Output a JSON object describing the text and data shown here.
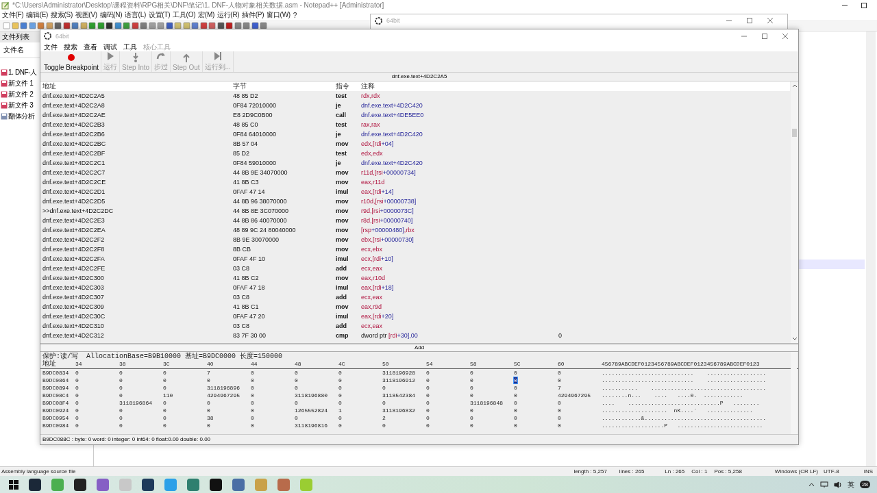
{
  "notepad": {
    "title": "*C:\\Users\\Administrator\\Desktop\\课程资料\\RPG相关\\DNF\\笔记\\1. DNF-人物对象相关数据.asm - Notepad++ [Administrator]",
    "menu": [
      "文件(F)",
      "编辑(E)",
      "搜索(S)",
      "视图(V)",
      "编码(N)",
      "语言(L)",
      "设置(T)",
      "工具(O)",
      "宏(M)",
      "运行(R)",
      "插件(P)",
      "窗口(W)",
      "?"
    ],
    "file_panel": {
      "title": "文件列表",
      "column": "文件名",
      "files": [
        "1. DNF-人",
        "新文件 1",
        "新文件 2",
        "新文件 3",
        "翻体分析"
      ]
    },
    "status_bar": {
      "file_type": "Assembly language source file",
      "length": "length : 5,257",
      "lines": "lines : 265",
      "ln": "Ln : 265",
      "col": "Col : 1",
      "pos": "Pos : 5,258",
      "eol": "Windows (CR LF)",
      "encoding": "UTF-8",
      "mode": "INS"
    }
  },
  "back_window": {
    "title": "64bit"
  },
  "debugger": {
    "title": "64bit",
    "menu": [
      {
        "label": "文件",
        "disabled": false
      },
      {
        "label": "搜索",
        "disabled": false
      },
      {
        "label": "查看",
        "disabled": false
      },
      {
        "label": "调试",
        "disabled": false
      },
      {
        "label": "工具",
        "disabled": false
      },
      {
        "label": "核心工具",
        "disabled": true
      }
    ],
    "toolbar": [
      {
        "kind": "breakpoint",
        "label": "Toggle Breakpoint",
        "disabled": false
      },
      {
        "kind": "run",
        "label": "运行",
        "disabled": true
      },
      {
        "kind": "step-into",
        "label": "Step Into",
        "disabled": true
      },
      {
        "kind": "step-over",
        "label": "步过",
        "disabled": true
      },
      {
        "kind": "step-out",
        "label": "Step Out",
        "disabled": true
      },
      {
        "kind": "run-to",
        "label": "运行到...",
        "disabled": true
      }
    ],
    "location": "dnf.exe.text+4D2C2A5",
    "columns": [
      "地址",
      "字节",
      "指令",
      "注释"
    ],
    "rows": [
      {
        "address": "dnf.exe.text+4D2C2A5",
        "bytes": "48 85 D2",
        "opcode": "test",
        "operand": [
          {
            "text": "rdx,rdx",
            "kind": "reg"
          }
        ]
      },
      {
        "address": "dnf.exe.text+4D2C2A8",
        "bytes": "0F84 72010000",
        "opcode": "je",
        "operand": [
          {
            "text": "dnf.exe.text+4D2C420",
            "kind": "num"
          }
        ]
      },
      {
        "address": "dnf.exe.text+4D2C2AE",
        "bytes": "E8 2D9C0B00",
        "opcode": "call",
        "operand": [
          {
            "text": "dnf.exe.text+4DE5EE0",
            "kind": "num"
          }
        ]
      },
      {
        "address": "dnf.exe.text+4D2C2B3",
        "bytes": "48 85 C0",
        "opcode": "test",
        "operand": [
          {
            "text": "rax,rax",
            "kind": "reg"
          }
        ]
      },
      {
        "address": "dnf.exe.text+4D2C2B6",
        "bytes": "0F84 64010000",
        "opcode": "je",
        "operand": [
          {
            "text": "dnf.exe.text+4D2C420",
            "kind": "num"
          }
        ]
      },
      {
        "address": "dnf.exe.text+4D2C2BC",
        "bytes": "8B 57 04",
        "opcode": "mov",
        "operand": [
          {
            "text": "edx,[rdi",
            "kind": "reg"
          },
          {
            "text": "+04]",
            "kind": "num"
          }
        ]
      },
      {
        "address": "dnf.exe.text+4D2C2BF",
        "bytes": "85 D2",
        "opcode": "test",
        "operand": [
          {
            "text": "edx,edx",
            "kind": "reg"
          }
        ]
      },
      {
        "address": "dnf.exe.text+4D2C2C1",
        "bytes": "0F84 59010000",
        "opcode": "je",
        "operand": [
          {
            "text": "dnf.exe.text+4D2C420",
            "kind": "num"
          }
        ]
      },
      {
        "address": "dnf.exe.text+4D2C2C7",
        "bytes": "44 8B 9E 34070000",
        "opcode": "mov",
        "operand": [
          {
            "text": "r11d,[rsi",
            "kind": "reg"
          },
          {
            "text": "+00000734]",
            "kind": "num"
          }
        ]
      },
      {
        "address": "dnf.exe.text+4D2C2CE",
        "bytes": "41 8B C3",
        "opcode": "mov",
        "operand": [
          {
            "text": "eax,r11d",
            "kind": "reg"
          }
        ]
      },
      {
        "address": "dnf.exe.text+4D2C2D1",
        "bytes": "0FAF 47 14",
        "opcode": "imul",
        "operand": [
          {
            "text": "eax,[rdi",
            "kind": "reg"
          },
          {
            "text": "+14]",
            "kind": "num"
          }
        ]
      },
      {
        "address": "dnf.exe.text+4D2C2D5",
        "bytes": "44 8B 96 38070000",
        "opcode": "mov",
        "operand": [
          {
            "text": "r10d,[rsi",
            "kind": "reg"
          },
          {
            "text": "+00000738]",
            "kind": "num"
          }
        ]
      },
      {
        "address": ">>dnf.exe.text+4D2C2DC",
        "bytes": "44 8B 8E 3C070000",
        "opcode": "mov",
        "operand": [
          {
            "text": "r9d,[rsi",
            "kind": "reg"
          },
          {
            "text": "+0000073C]",
            "kind": "num"
          }
        ]
      },
      {
        "address": "dnf.exe.text+4D2C2E3",
        "bytes": "44 8B 86 40070000",
        "opcode": "mov",
        "operand": [
          {
            "text": "r8d,[rsi",
            "kind": "reg"
          },
          {
            "text": "+00000740]",
            "kind": "num"
          }
        ]
      },
      {
        "address": "dnf.exe.text+4D2C2EA",
        "bytes": "48 89 9C 24 80040000",
        "opcode": "mov",
        "operand": [
          {
            "text": "[rsp",
            "kind": "reg"
          },
          {
            "text": "+00000480]",
            "kind": "num"
          },
          {
            "text": ",rbx",
            "kind": "reg"
          }
        ]
      },
      {
        "address": "dnf.exe.text+4D2C2F2",
        "bytes": "8B 9E 30070000",
        "opcode": "mov",
        "operand": [
          {
            "text": "ebx,[rsi",
            "kind": "reg"
          },
          {
            "text": "+00000730]",
            "kind": "num"
          }
        ]
      },
      {
        "address": "dnf.exe.text+4D2C2F8",
        "bytes": "8B CB",
        "opcode": "mov",
        "operand": [
          {
            "text": "ecx,ebx",
            "kind": "reg"
          }
        ]
      },
      {
        "address": "dnf.exe.text+4D2C2FA",
        "bytes": "0FAF 4F 10",
        "opcode": "imul",
        "operand": [
          {
            "text": "ecx,[rdi",
            "kind": "reg"
          },
          {
            "text": "+10]",
            "kind": "num"
          }
        ]
      },
      {
        "address": "dnf.exe.text+4D2C2FE",
        "bytes": "03 C8",
        "opcode": "add",
        "operand": [
          {
            "text": "ecx,eax",
            "kind": "reg"
          }
        ]
      },
      {
        "address": "dnf.exe.text+4D2C300",
        "bytes": "41 8B C2",
        "opcode": "mov",
        "operand": [
          {
            "text": "eax,r10d",
            "kind": "reg"
          }
        ]
      },
      {
        "address": "dnf.exe.text+4D2C303",
        "bytes": "0FAF 47 18",
        "opcode": "imul",
        "operand": [
          {
            "text": "eax,[rdi",
            "kind": "reg"
          },
          {
            "text": "+18]",
            "kind": "num"
          }
        ]
      },
      {
        "address": "dnf.exe.text+4D2C307",
        "bytes": "03 C8",
        "opcode": "add",
        "operand": [
          {
            "text": "ecx,eax",
            "kind": "reg"
          }
        ]
      },
      {
        "address": "dnf.exe.text+4D2C309",
        "bytes": "41 8B C1",
        "opcode": "mov",
        "operand": [
          {
            "text": "eax,r9d",
            "kind": "reg"
          }
        ]
      },
      {
        "address": "dnf.exe.text+4D2C30C",
        "bytes": "0FAF 47 20",
        "opcode": "imul",
        "operand": [
          {
            "text": "eax,[rdi",
            "kind": "reg"
          },
          {
            "text": "+20]",
            "kind": "num"
          }
        ]
      },
      {
        "address": "dnf.exe.text+4D2C310",
        "bytes": "03 C8",
        "opcode": "add",
        "operand": [
          {
            "text": "ecx,eax",
            "kind": "reg"
          }
        ]
      },
      {
        "address": "dnf.exe.text+4D2C312",
        "bytes": "83 7F 30 00",
        "opcode": "cmp",
        "operand": [
          {
            "text": "dword ptr ",
            "kind": "plain"
          },
          {
            "text": "[rdi",
            "kind": "reg"
          },
          {
            "text": "+30],00",
            "kind": "num"
          }
        ],
        "comment": "0"
      }
    ],
    "add_label": "Add",
    "hex": {
      "info": "保护:读/写  AllocationBase=B9B10000 基址=B9DC0000 长度=150000",
      "address_header": "地址",
      "columns": [
        "34",
        "38",
        "3C",
        "40",
        "44",
        "48",
        "4C",
        "50",
        "54",
        "58",
        "5C",
        "60"
      ],
      "ascii_header": "456789ABCDEF0123456789ABCDEF0123456789ABCDEF0123",
      "rows": [
        {
          "address": "B9DC0834",
          "cells": [
            {
              "value": "0",
              "selected": false
            },
            {
              "value": "0",
              "selected": false
            },
            {
              "value": "0",
              "selected": false
            },
            {
              "value": "7",
              "selected": false
            },
            {
              "value": "0",
              "selected": false
            },
            {
              "value": "0",
              "selected": false
            },
            {
              "value": "0",
              "selected": false
            },
            {
              "value": "3118196928",
              "selected": false
            },
            {
              "value": "0",
              "selected": false
            },
            {
              "value": "0",
              "selected": false
            },
            {
              "value": "0",
              "selected": false
            },
            {
              "value": "0",
              "selected": false
            }
          ],
          "ascii": "............................    .................."
        },
        {
          "address": "B9DC0864",
          "cells": [
            {
              "value": "0",
              "selected": false
            },
            {
              "value": "0",
              "selected": false
            },
            {
              "value": "0",
              "selected": false
            },
            {
              "value": "0",
              "selected": false
            },
            {
              "value": "0",
              "selected": false
            },
            {
              "value": "0",
              "selected": false
            },
            {
              "value": "0",
              "selected": false
            },
            {
              "value": "3118196912",
              "selected": false
            },
            {
              "value": "0",
              "selected": false
            },
            {
              "value": "0",
              "selected": false
            },
            {
              "value": "0",
              "selected": true
            },
            {
              "value": "0",
              "selected": false
            }
          ],
          "ascii": "............................    .................."
        },
        {
          "address": "B9DC0894",
          "cells": [
            {
              "value": "0",
              "selected": false
            },
            {
              "value": "0",
              "selected": false
            },
            {
              "value": "0",
              "selected": false
            },
            {
              "value": "3118196896",
              "selected": false
            },
            {
              "value": "0",
              "selected": false
            },
            {
              "value": "0",
              "selected": false
            },
            {
              "value": "0",
              "selected": false
            },
            {
              "value": "0",
              "selected": false
            },
            {
              "value": "0",
              "selected": false
            },
            {
              "value": "0",
              "selected": false
            },
            {
              "value": "0",
              "selected": false
            },
            {
              "value": "7",
              "selected": false
            }
          ],
          "ascii": "...........    ..................................."
        },
        {
          "address": "B9DC08C4",
          "cells": [
            {
              "value": "0",
              "selected": false
            },
            {
              "value": "0",
              "selected": false
            },
            {
              "value": "110",
              "selected": false
            },
            {
              "value": "4294967295",
              "selected": false
            },
            {
              "value": "0",
              "selected": false
            },
            {
              "value": "3118196880",
              "selected": false
            },
            {
              "value": "0",
              "selected": false
            },
            {
              "value": "3118542384",
              "selected": false
            },
            {
              "value": "0",
              "selected": false
            },
            {
              "value": "0",
              "selected": false
            },
            {
              "value": "0",
              "selected": false
            },
            {
              "value": "4294967295",
              "selected": false
            }
          ],
          "ascii": "........n...    ....   ....0.  ............"
        },
        {
          "address": "B9DC08F4",
          "cells": [
            {
              "value": "0",
              "selected": false
            },
            {
              "value": "3118196864",
              "selected": false
            },
            {
              "value": "0",
              "selected": false
            },
            {
              "value": "0",
              "selected": false
            },
            {
              "value": "0",
              "selected": false
            },
            {
              "value": "0",
              "selected": false
            },
            {
              "value": "0",
              "selected": false
            },
            {
              "value": "0",
              "selected": false
            },
            {
              "value": "0",
              "selected": false
            },
            {
              "value": "3118196848",
              "selected": false
            },
            {
              "value": "0",
              "selected": false
            },
            {
              "value": "0",
              "selected": false
            }
          ],
          "ascii": "....    ............................P   ........"
        },
        {
          "address": "B9DC0924",
          "cells": [
            {
              "value": "0",
              "selected": false
            },
            {
              "value": "0",
              "selected": false
            },
            {
              "value": "0",
              "selected": false
            },
            {
              "value": "0",
              "selected": false
            },
            {
              "value": "0",
              "selected": false
            },
            {
              "value": "1265552824",
              "selected": false
            },
            {
              "value": "1",
              "selected": false
            },
            {
              "value": "3118196832",
              "selected": false
            },
            {
              "value": "0",
              "selected": false
            },
            {
              "value": "0",
              "selected": false
            },
            {
              "value": "0",
              "selected": false
            },
            {
              "value": "0",
              "selected": false
            }
          ],
          "ascii": "....................  nK....`   .............."
        },
        {
          "address": "B9DC0954",
          "cells": [
            {
              "value": "0",
              "selected": false
            },
            {
              "value": "0",
              "selected": false
            },
            {
              "value": "0",
              "selected": false
            },
            {
              "value": "38",
              "selected": false
            },
            {
              "value": "0",
              "selected": false
            },
            {
              "value": "0",
              "selected": false
            },
            {
              "value": "0",
              "selected": false
            },
            {
              "value": "2",
              "selected": false
            },
            {
              "value": "0",
              "selected": false
            },
            {
              "value": "0",
              "selected": false
            },
            {
              "value": "0",
              "selected": false
            },
            {
              "value": "0",
              "selected": false
            }
          ],
          "ascii": "............&....................................."
        },
        {
          "address": "B9DC0984",
          "cells": [
            {
              "value": "0",
              "selected": false
            },
            {
              "value": "0",
              "selected": false
            },
            {
              "value": "0",
              "selected": false
            },
            {
              "value": "0",
              "selected": false
            },
            {
              "value": "0",
              "selected": false
            },
            {
              "value": "3118196816",
              "selected": false
            },
            {
              "value": "0",
              "selected": false
            },
            {
              "value": "0",
              "selected": false
            },
            {
              "value": "0",
              "selected": false
            },
            {
              "value": "0",
              "selected": false
            },
            {
              "value": "0",
              "selected": false
            },
            {
              "value": "0",
              "selected": false
            }
          ],
          "ascii": "...................P   .........................."
        }
      ]
    },
    "status": "B9DC088C : byte: 0 word: 0 integer: 0 int64: 0 float:0.00 double: 0.00"
  },
  "taskbar": {
    "apps": [
      {
        "color": "#1b2838"
      },
      {
        "color": "#4caf50"
      },
      {
        "color": "#222222"
      },
      {
        "color": "#865fc5"
      },
      {
        "color": "#c8c8c8"
      },
      {
        "color": "#1e3a5a"
      },
      {
        "color": "#2aa0e8"
      },
      {
        "color": "#2f7f6f"
      },
      {
        "color": "#111111"
      },
      {
        "color": "#4a6fa5"
      },
      {
        "color": "#c9a24a"
      },
      {
        "color": "#b86b4b"
      },
      {
        "color": "#9acd32"
      }
    ],
    "language": "英",
    "notifications": "28"
  }
}
